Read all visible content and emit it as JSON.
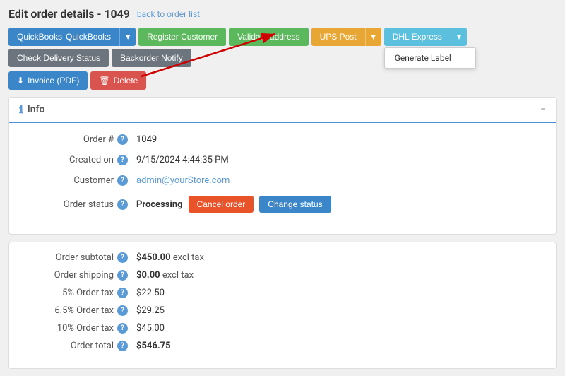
{
  "page": {
    "title": "Edit order details - 1049",
    "back_link": "back to order list",
    "back_href": "#"
  },
  "toolbar": {
    "quickbooks_label": "QuickBooks",
    "register_customer_label": "Register Customer",
    "validate_address_label": "Validate address",
    "ups_post_label": "UPS Post",
    "dhl_express_label": "DHL Express",
    "check_delivery_status_label": "Check Delivery Status",
    "backorder_notify_label": "Backorder Notify",
    "invoice_pdf_label": "Invoice (PDF)",
    "delete_label": "Delete",
    "generate_label": "Generate Label"
  },
  "info_card": {
    "title": "Info",
    "collapse_symbol": "−",
    "fields": {
      "order_number_label": "Order #",
      "order_number_value": "1049",
      "created_on_label": "Created on",
      "created_on_value": "9/15/2024 4:44:35 PM",
      "customer_label": "Customer",
      "customer_value": "admin@yourStore.com",
      "order_status_label": "Order status",
      "order_status_value": "Processing",
      "cancel_order_label": "Cancel order",
      "change_status_label": "Change status"
    }
  },
  "summary": {
    "order_subtotal_label": "Order subtotal",
    "order_subtotal_value": "$450.00",
    "order_subtotal_suffix": "excl tax",
    "order_shipping_label": "Order shipping",
    "order_shipping_value": "$0.00",
    "order_shipping_suffix": "excl tax",
    "tax1_label": "5% Order tax",
    "tax1_value": "$22.50",
    "tax2_label": "6.5% Order tax",
    "tax2_value": "$29.25",
    "tax3_label": "10% Order tax",
    "tax3_value": "$45.00",
    "order_total_label": "Order total",
    "order_total_value": "$546.75"
  },
  "icons": {
    "info": "ℹ",
    "help": "?",
    "download": "⬇",
    "trash": "🗑",
    "arrow_down": "▾",
    "minus": "−"
  }
}
